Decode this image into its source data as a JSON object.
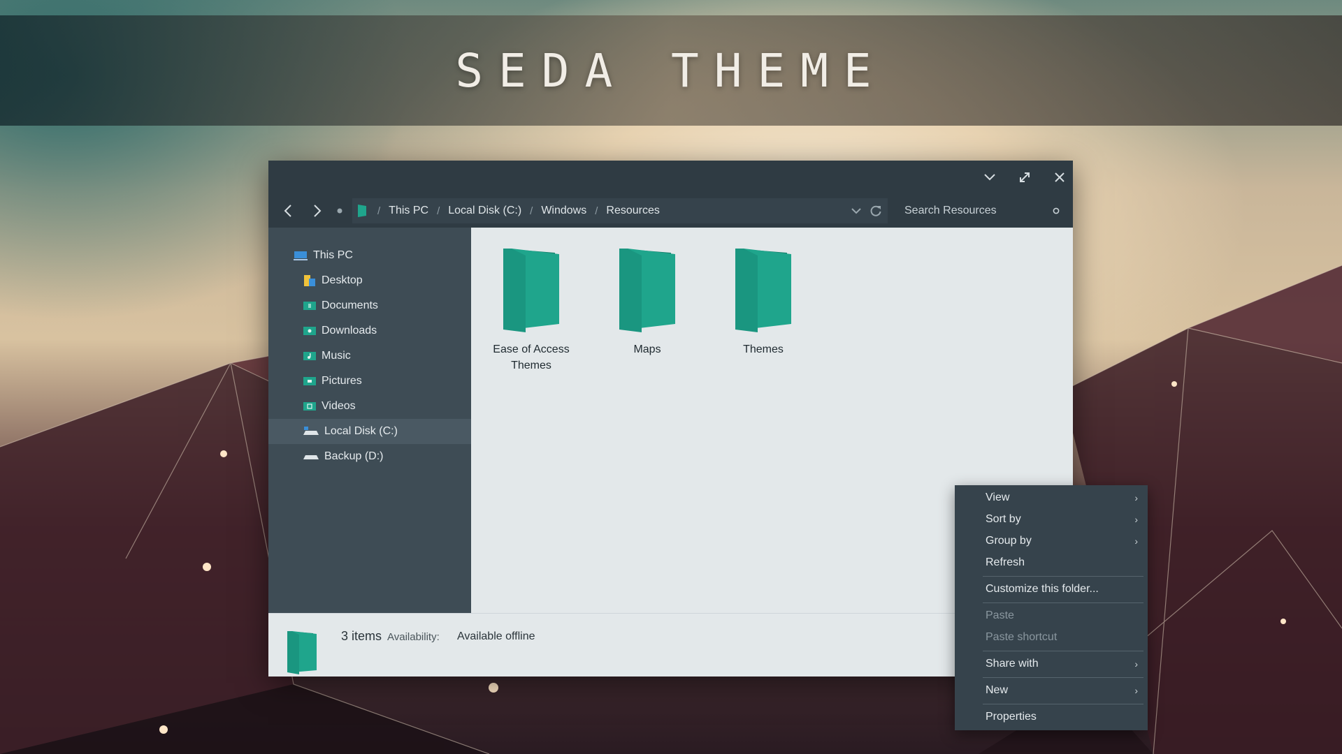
{
  "banner": {
    "title": "SEDA THEME"
  },
  "window": {
    "controls": {
      "minimize_icon": "chevron-down-icon",
      "maximize_icon": "expand-icon",
      "close_icon": "close-icon"
    },
    "breadcrumb": [
      "This PC",
      "Local Disk (C:)",
      "Windows",
      "Resources"
    ],
    "search": {
      "placeholder": "Search Resources"
    },
    "sidebar": {
      "items": [
        {
          "label": "This PC",
          "icon": "computer-icon"
        },
        {
          "label": "Desktop",
          "icon": "desktop-icon"
        },
        {
          "label": "Documents",
          "icon": "documents-icon"
        },
        {
          "label": "Downloads",
          "icon": "downloads-icon"
        },
        {
          "label": "Music",
          "icon": "music-icon"
        },
        {
          "label": "Pictures",
          "icon": "pictures-icon"
        },
        {
          "label": "Videos",
          "icon": "videos-icon"
        },
        {
          "label": "Local Disk (C:)",
          "icon": "drive-icon",
          "selected": true
        },
        {
          "label": "Backup (D:)",
          "icon": "drive-icon"
        }
      ]
    },
    "folders": [
      {
        "label_line1": "Ease of Access",
        "label_line2": "Themes"
      },
      {
        "label_line1": "Maps",
        "label_line2": ""
      },
      {
        "label_line1": "Themes",
        "label_line2": ""
      }
    ],
    "status": {
      "count": "3 items",
      "availability_label": "Availability:",
      "availability_value": "Available offline"
    }
  },
  "context_menu": {
    "items": [
      {
        "label": "View",
        "submenu": true
      },
      {
        "label": "Sort by",
        "submenu": true
      },
      {
        "label": "Group by",
        "submenu": true
      },
      {
        "label": "Refresh",
        "submenu": false
      },
      {
        "label": "Customize this folder...",
        "submenu": false
      },
      {
        "label": "Paste",
        "submenu": false,
        "disabled": true
      },
      {
        "label": "Paste shortcut",
        "submenu": false,
        "disabled": true
      },
      {
        "label": "Share with",
        "submenu": true
      },
      {
        "label": "New",
        "submenu": true
      },
      {
        "label": "Properties",
        "submenu": false
      }
    ]
  },
  "colors": {
    "accent": "#1fa58c",
    "accent_dark": "#16806c",
    "dark": "#2f3b43",
    "sidebar": "#3e4c55",
    "content": "#e3e8ea"
  }
}
